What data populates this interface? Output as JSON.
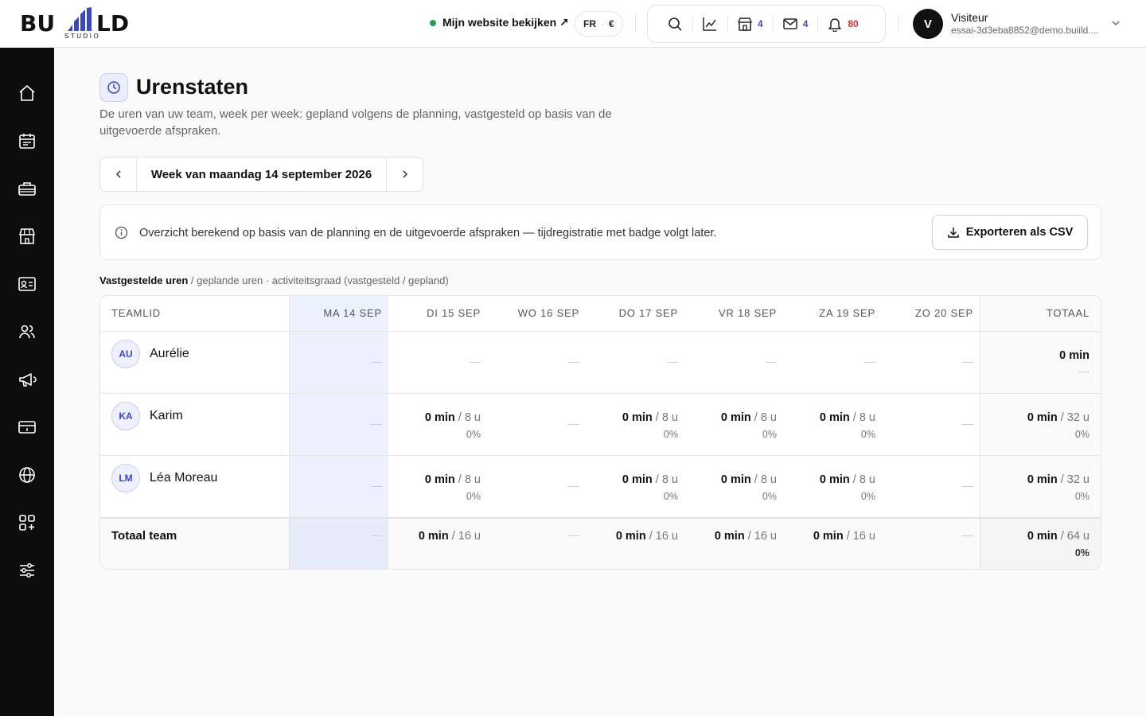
{
  "brand": {
    "name": "BU  LD",
    "sub": "STUDIO"
  },
  "topbar": {
    "website_link": "Mijn website bekijken ↗",
    "lang": "FR",
    "lang_sep": "·",
    "currency": "€",
    "tools": {
      "shop_count": "4",
      "mail_count": "4",
      "bell_count": "80"
    },
    "user": {
      "initial": "V",
      "name": "Visiteur",
      "email": "essai-3d3eba8852@demo.buiild...."
    }
  },
  "page": {
    "title": "Urenstaten",
    "subtitle": "De uren van uw team, week per week: gepland volgens de planning, vastgesteld op basis van de uitgevoerde afspraken.",
    "week_label": "Week van maandag 14 september 2026",
    "info_text": "Overzicht berekend op basis van de planning en de uitgevoerde afspraken — tijdregistratie met badge volgt later.",
    "export_label": "Exporteren als CSV",
    "legend_bold": "Vastgestelde uren",
    "legend_rest": " / geplande uren · activiteitsgraad (vastgesteld / gepland)"
  },
  "table": {
    "headers": [
      "TEAMLID",
      "MA 14 SEP",
      "DI 15 SEP",
      "WO 16 SEP",
      "DO 17 SEP",
      "VR 18 SEP",
      "ZA 19 SEP",
      "ZO 20 SEP",
      "TOTAAL"
    ],
    "rows": [
      {
        "initials": "AU",
        "name": "Aurélie",
        "days": [
          null,
          null,
          null,
          null,
          null,
          null,
          null
        ],
        "total": {
          "value": "0 min",
          "planned": "",
          "pct": ""
        }
      },
      {
        "initials": "KA",
        "name": "Karim",
        "days": [
          null,
          {
            "value": "0 min",
            "planned": " / 8 u",
            "pct": "0%"
          },
          null,
          {
            "value": "0 min",
            "planned": " / 8 u",
            "pct": "0%"
          },
          {
            "value": "0 min",
            "planned": " / 8 u",
            "pct": "0%"
          },
          {
            "value": "0 min",
            "planned": " / 8 u",
            "pct": "0%"
          },
          null
        ],
        "total": {
          "value": "0 min",
          "planned": " / 32 u",
          "pct": "0%"
        }
      },
      {
        "initials": "LM",
        "name": "Léa Moreau",
        "days": [
          null,
          {
            "value": "0 min",
            "planned": " / 8 u",
            "pct": "0%"
          },
          null,
          {
            "value": "0 min",
            "planned": " / 8 u",
            "pct": "0%"
          },
          {
            "value": "0 min",
            "planned": " / 8 u",
            "pct": "0%"
          },
          {
            "value": "0 min",
            "planned": " / 8 u",
            "pct": "0%"
          },
          null
        ],
        "total": {
          "value": "0 min",
          "planned": " / 32 u",
          "pct": "0%"
        }
      }
    ],
    "team_total": {
      "label": "Totaal team",
      "days": [
        null,
        {
          "value": "0 min",
          "planned": " / 16 u"
        },
        null,
        {
          "value": "0 min",
          "planned": " / 16 u"
        },
        {
          "value": "0 min",
          "planned": " / 16 u"
        },
        {
          "value": "0 min",
          "planned": " / 16 u"
        },
        null
      ],
      "total": {
        "value": "0 min",
        "planned": " / 64 u",
        "pct": "0%"
      }
    }
  },
  "colors": {
    "accent": "#3b48c4",
    "accent_bg": "#edf0fd",
    "alert": "#d23030",
    "online": "#22a04b"
  }
}
